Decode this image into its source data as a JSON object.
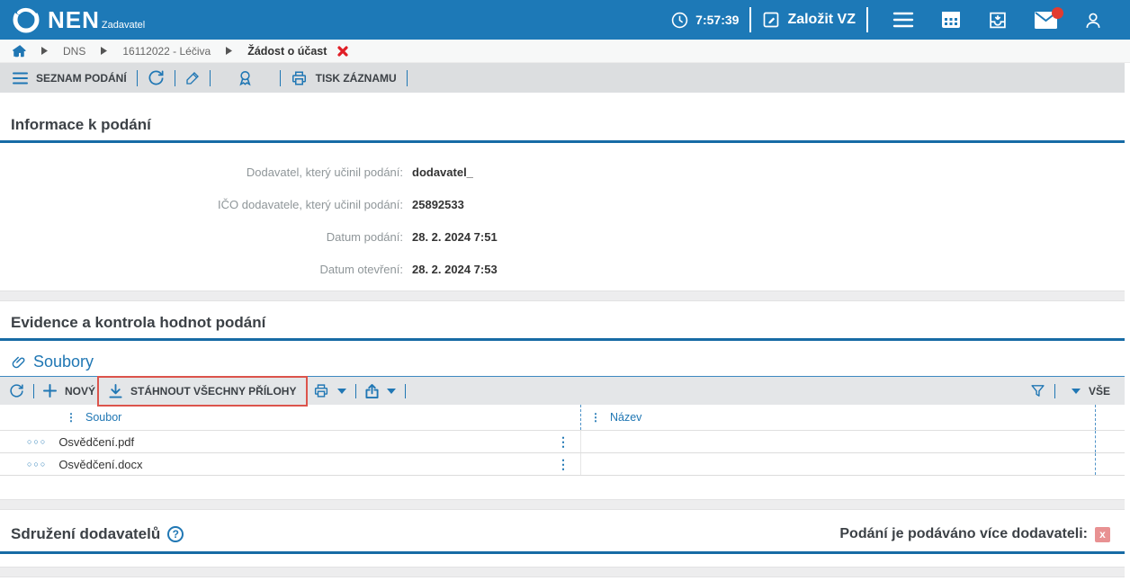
{
  "colors": {
    "header_bg": "#1d79b7",
    "accent_blue": "#2077b4",
    "section_rule_blue": "#176ba5",
    "toolbar_gray": "#dcdee0",
    "alert_red": "#e01e26",
    "annotation_red": "#dc544c",
    "flag_no_bg": "#e89192"
  },
  "icons": {
    "logo": "nen-logo-icon",
    "clock": "clock-icon",
    "create": "edit-square-icon",
    "menu": "menu-icon",
    "calendar": "calendar-icon",
    "inbox": "inbox-tray-icon",
    "mail": "mail-icon",
    "user": "user-icon",
    "home": "home-icon",
    "breadcrumb_caret": "caret-right-icon",
    "close": "close-icon",
    "refresh": "refresh-icon",
    "edit": "pencil-icon",
    "award": "award-icon",
    "print": "printer-icon",
    "attachment": "attachment-icon",
    "add": "plus-icon",
    "download": "download-icon",
    "export": "export-icon",
    "filter": "funnel-icon",
    "help": "help-icon",
    "column_handle": "vertical-dots-icon",
    "row_record": "record-circles-icon",
    "row_menu": "vertical-dots-icon"
  },
  "header": {
    "brand": "NEN",
    "role": "Zadavatel",
    "time": "7:57:39",
    "create_vz_label": "Založit VZ"
  },
  "breadcrumb": {
    "items": [
      "DNS",
      "16112022 - Léčiva",
      "Žádost o účast"
    ]
  },
  "record_toolbar": {
    "list_label": "SEZNAM PODÁNÍ",
    "print_label": "TISK ZÁZNAMU"
  },
  "info_section": {
    "title": "Informace k podání",
    "fields": [
      {
        "label": "Dodavatel, který učinil podání:",
        "value": "dodavatel_"
      },
      {
        "label": "IČO dodavatele, který učinil podání:",
        "value": "25892533"
      },
      {
        "label": "Datum podání:",
        "value": "28. 2. 2024 7:51"
      },
      {
        "label": "Datum otevření:",
        "value": "28. 2. 2024 7:53"
      }
    ]
  },
  "evidence_section": {
    "title": "Evidence a kontrola hodnot podání"
  },
  "files": {
    "title": "Soubory",
    "new_label": "NOVÝ",
    "download_all_label": "STÁHNOUT VŠECHNY PŘÍLOHY",
    "filter_value": "VŠE",
    "columns": [
      "Soubor",
      "Název"
    ],
    "rows": [
      {
        "soubor": "Osvědčení.pdf",
        "nazev": ""
      },
      {
        "soubor": "Osvědčení.docx",
        "nazev": ""
      }
    ]
  },
  "association_section": {
    "title": "Sdružení dodavatelů",
    "flag_label": "Podání je podáváno více dodavateli:",
    "flag_value": "x"
  }
}
